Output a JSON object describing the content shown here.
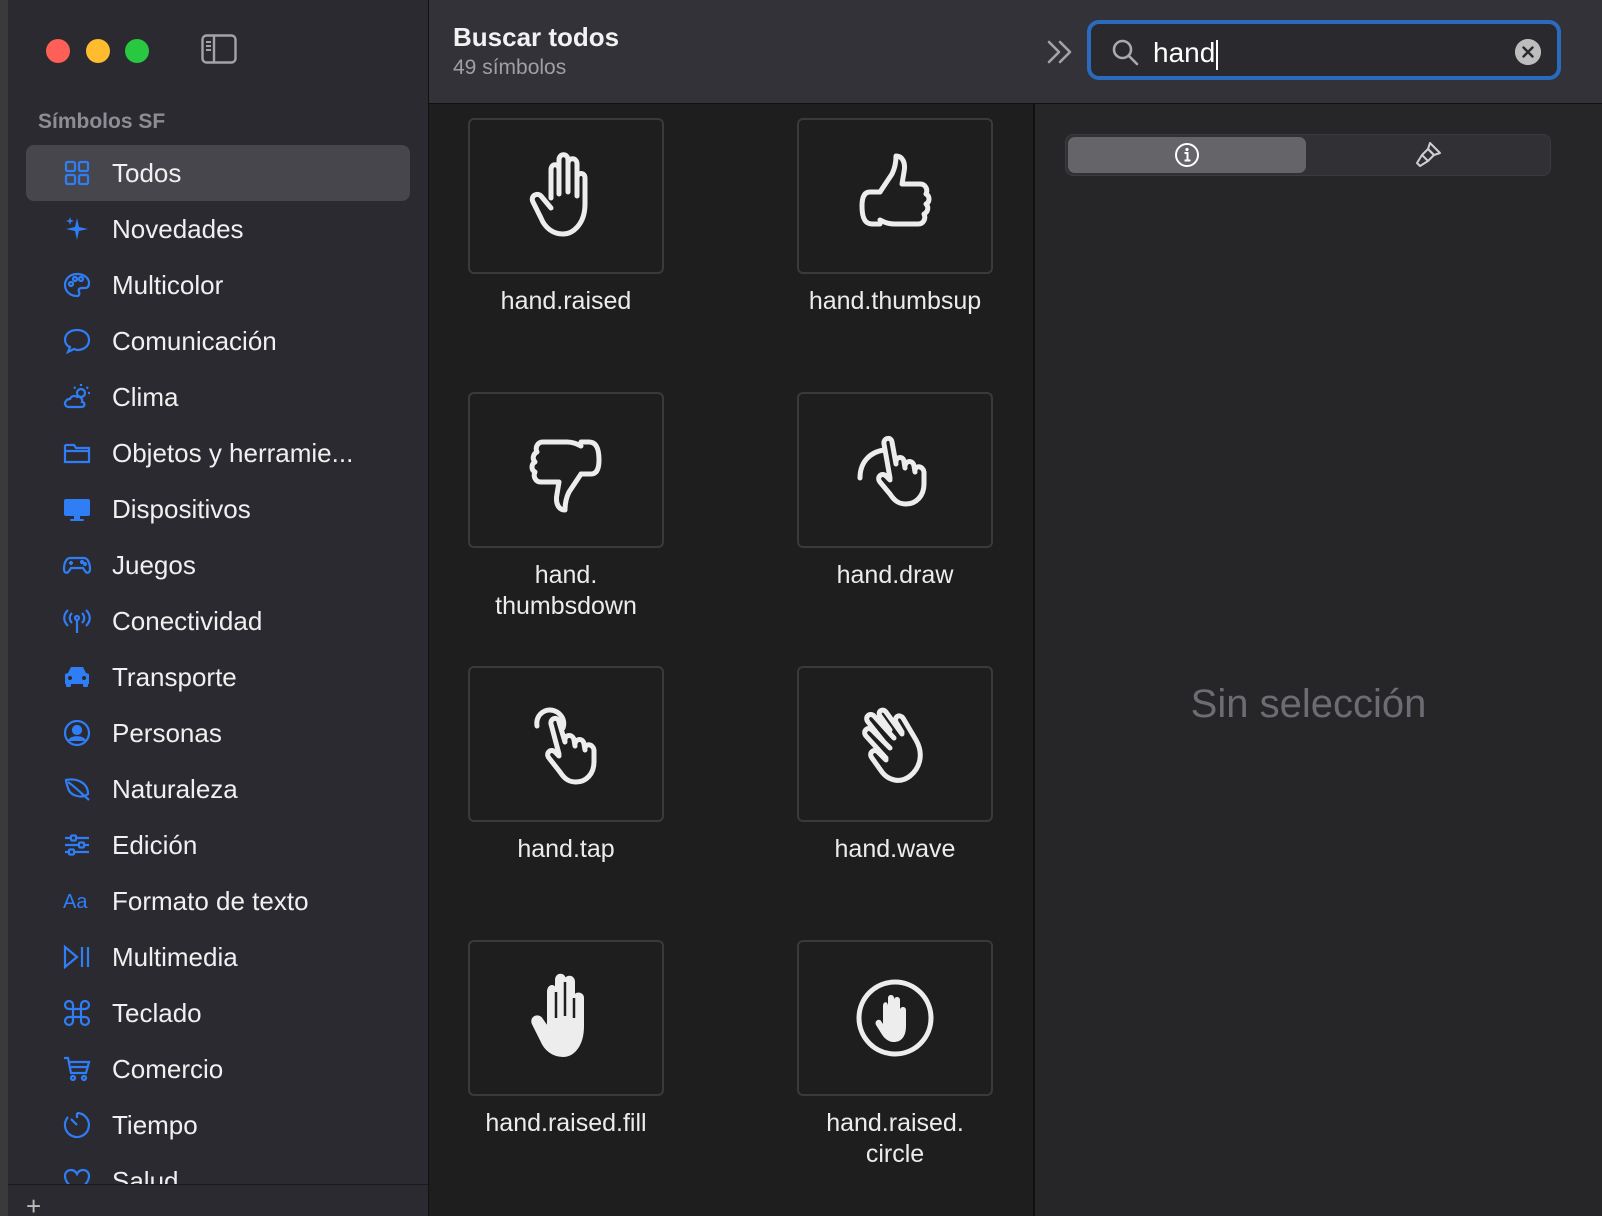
{
  "toolbar": {
    "title": "Buscar todos",
    "subtitle": "49 símbolos",
    "search_value": "hand"
  },
  "sidebar": {
    "section_label": "Símbolos SF",
    "items": [
      {
        "label": "Todos",
        "icon": "grid-icon"
      },
      {
        "label": "Novedades",
        "icon": "sparkles-icon"
      },
      {
        "label": "Multicolor",
        "icon": "paintpalette-icon"
      },
      {
        "label": "Comunicación",
        "icon": "message-bubble-icon"
      },
      {
        "label": "Clima",
        "icon": "cloud-sun-icon"
      },
      {
        "label": "Objetos y herramie...",
        "icon": "folder-icon"
      },
      {
        "label": "Dispositivos",
        "icon": "desktop-computer-icon"
      },
      {
        "label": "Juegos",
        "icon": "gamecontroller-icon"
      },
      {
        "label": "Conectividad",
        "icon": "antenna-icon"
      },
      {
        "label": "Transporte",
        "icon": "car-icon"
      },
      {
        "label": "Personas",
        "icon": "person-circle-icon"
      },
      {
        "label": "Naturaleza",
        "icon": "leaf-icon"
      },
      {
        "label": "Edición",
        "icon": "sliders-icon"
      },
      {
        "label": "Formato de texto",
        "icon": "textformat-icon"
      },
      {
        "label": "Multimedia",
        "icon": "play-pause-icon"
      },
      {
        "label": "Teclado",
        "icon": "command-icon"
      },
      {
        "label": "Comercio",
        "icon": "cart-icon"
      },
      {
        "label": "Tiempo",
        "icon": "timer-icon"
      },
      {
        "label": "Salud",
        "icon": "heart-icon"
      }
    ]
  },
  "symbols": [
    {
      "label": "hand.raised",
      "icon": "hand-raised-icon"
    },
    {
      "label": "hand.thumbsup",
      "icon": "hand-thumbsup-icon"
    },
    {
      "label": "hand.\nthumbsdown",
      "icon": "hand-thumbsdown-icon"
    },
    {
      "label": "hand.draw",
      "icon": "hand-draw-icon"
    },
    {
      "label": "hand.tap",
      "icon": "hand-tap-icon"
    },
    {
      "label": "hand.wave",
      "icon": "hand-wave-icon"
    },
    {
      "label": "hand.raised.fill",
      "icon": "hand-raised-fill-icon"
    },
    {
      "label": "hand.raised.\ncircle",
      "icon": "hand-raised-circle-icon"
    }
  ],
  "inspector": {
    "empty_text": "Sin selección"
  },
  "colors": {
    "accent": "#2f7ef5",
    "sidebar_bg": "#2b2a31",
    "search_focus": "#2a6bbf"
  }
}
